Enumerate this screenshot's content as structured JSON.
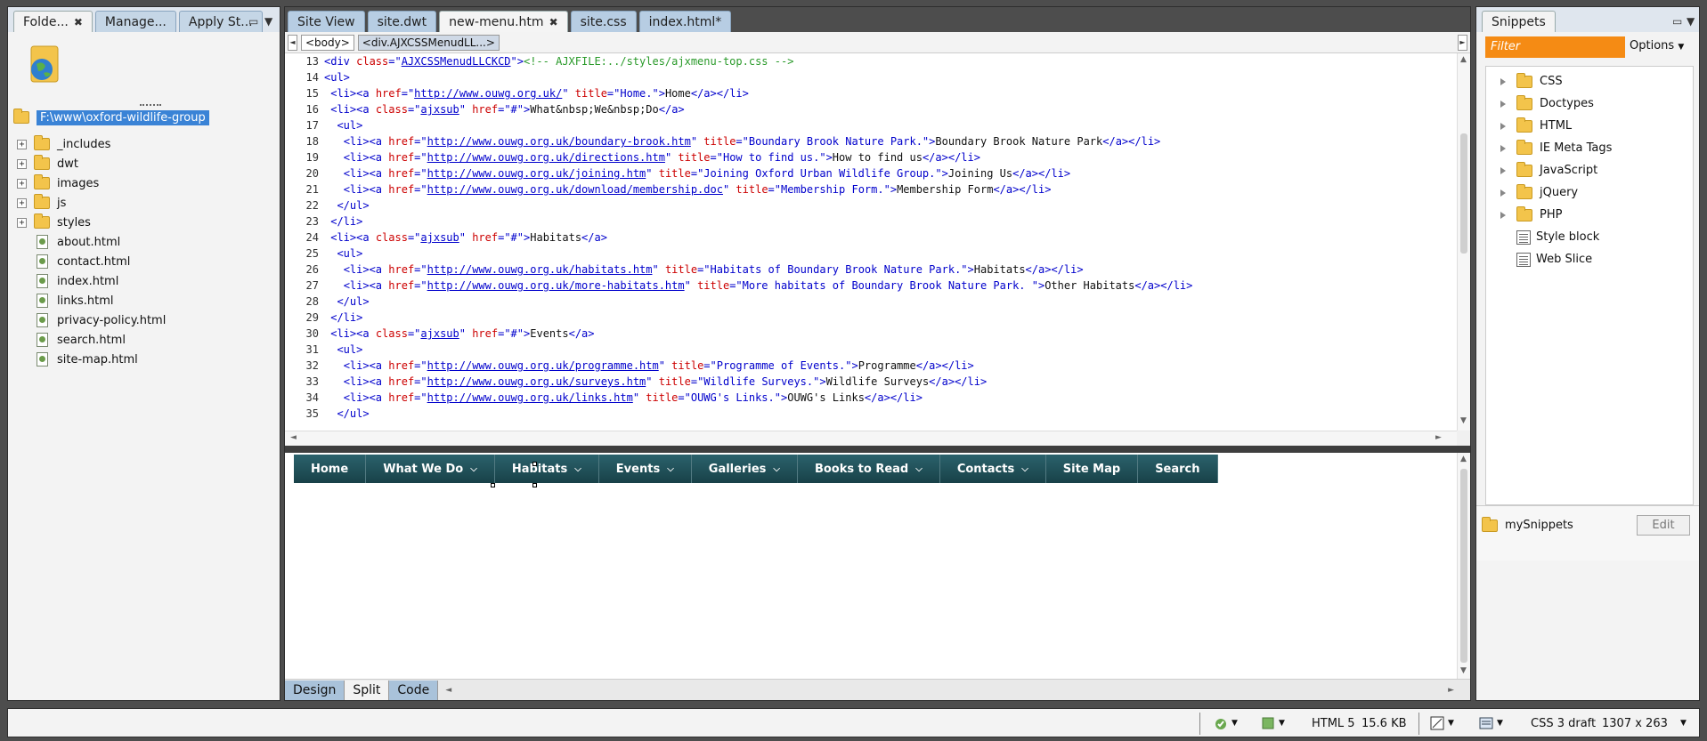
{
  "files_panel": {
    "tabs": [
      {
        "label": "Folde...",
        "close": "✖"
      },
      {
        "label": "Manage..."
      },
      {
        "label": "Apply St..."
      }
    ],
    "root_path": "F:\\www\\oxford-wildlife-group",
    "items": [
      {
        "kind": "folder",
        "name": "_includes"
      },
      {
        "kind": "folder",
        "name": "dwt"
      },
      {
        "kind": "folder",
        "name": "images"
      },
      {
        "kind": "folder",
        "name": "js"
      },
      {
        "kind": "folder",
        "name": "styles"
      },
      {
        "kind": "file",
        "name": "about.html"
      },
      {
        "kind": "file",
        "name": "contact.html"
      },
      {
        "kind": "file",
        "name": "index.html"
      },
      {
        "kind": "file",
        "name": "links.html"
      },
      {
        "kind": "file",
        "name": "privacy-policy.html"
      },
      {
        "kind": "file",
        "name": "search.html"
      },
      {
        "kind": "file",
        "name": "site-map.html"
      }
    ],
    "expander": "+"
  },
  "editor": {
    "tabs": [
      "Site View",
      "site.dwt",
      "new-menu.htm",
      "site.css",
      "index.html*"
    ],
    "active_tab_close": "✖",
    "breadcrumbs": [
      "<body>",
      "<div.AJXCSSMenudLL...>"
    ],
    "code_lines": [
      {
        "n": "13",
        "parts": [
          [
            "tg",
            "<div "
          ],
          [
            "at",
            "class"
          ],
          [
            "tg",
            "=\""
          ],
          [
            "vl",
            "AJXCSSMenudLLCKCD"
          ],
          [
            "tg",
            "\">"
          ],
          [
            "cm",
            "<!-- AJXFILE:../styles/ajxmenu-top.css -->"
          ]
        ]
      },
      {
        "n": "14",
        "parts": [
          [
            "tg",
            "<ul>"
          ]
        ]
      },
      {
        "n": "15",
        "parts": [
          [
            "tx",
            " "
          ],
          [
            "tg",
            "<li><a "
          ],
          [
            "at",
            "href"
          ],
          [
            "tg",
            "=\""
          ],
          [
            "vl",
            "http://www.ouwg.org.uk/"
          ],
          [
            "tg",
            "\" "
          ],
          [
            "at",
            "title"
          ],
          [
            "vs",
            "=\"Home.\""
          ],
          [
            "tg",
            ">"
          ],
          [
            "tx",
            "Home"
          ],
          [
            "tg",
            "</a></li>"
          ]
        ]
      },
      {
        "n": "16",
        "parts": [
          [
            "tx",
            " "
          ],
          [
            "tg",
            "<li><a "
          ],
          [
            "at",
            "class"
          ],
          [
            "tg",
            "=\""
          ],
          [
            "vl",
            "ajxsub"
          ],
          [
            "tg",
            "\" "
          ],
          [
            "at",
            "href"
          ],
          [
            "vs",
            "=\"#\""
          ],
          [
            "tg",
            ">"
          ],
          [
            "tx",
            "What&nbsp;We&nbsp;Do"
          ],
          [
            "tg",
            "</a>"
          ]
        ]
      },
      {
        "n": "17",
        "parts": [
          [
            "tx",
            "  "
          ],
          [
            "tg",
            "<ul>"
          ]
        ]
      },
      {
        "n": "18",
        "parts": [
          [
            "tx",
            "   "
          ],
          [
            "tg",
            "<li><a "
          ],
          [
            "at",
            "href"
          ],
          [
            "tg",
            "=\""
          ],
          [
            "vl",
            "http://www.ouwg.org.uk/boundary-brook.htm"
          ],
          [
            "tg",
            "\" "
          ],
          [
            "at",
            "title"
          ],
          [
            "vs",
            "=\"Boundary Brook Nature Park.\""
          ],
          [
            "tg",
            ">"
          ],
          [
            "tx",
            "Boundary Brook Nature Park"
          ],
          [
            "tg",
            "</a></li>"
          ]
        ]
      },
      {
        "n": "19",
        "parts": [
          [
            "tx",
            "   "
          ],
          [
            "tg",
            "<li><a "
          ],
          [
            "at",
            "href"
          ],
          [
            "tg",
            "=\""
          ],
          [
            "vl",
            "http://www.ouwg.org.uk/directions.htm"
          ],
          [
            "tg",
            "\" "
          ],
          [
            "at",
            "title"
          ],
          [
            "vs",
            "=\"How to find us.\""
          ],
          [
            "tg",
            ">"
          ],
          [
            "tx",
            "How to find us"
          ],
          [
            "tg",
            "</a></li>"
          ]
        ]
      },
      {
        "n": "20",
        "parts": [
          [
            "tx",
            "   "
          ],
          [
            "tg",
            "<li><a "
          ],
          [
            "at",
            "href"
          ],
          [
            "tg",
            "=\""
          ],
          [
            "vl",
            "http://www.ouwg.org.uk/joining.htm"
          ],
          [
            "tg",
            "\" "
          ],
          [
            "at",
            "title"
          ],
          [
            "vs",
            "=\"Joining Oxford Urban Wildlife Group.\""
          ],
          [
            "tg",
            ">"
          ],
          [
            "tx",
            "Joining Us"
          ],
          [
            "tg",
            "</a></li>"
          ]
        ]
      },
      {
        "n": "21",
        "parts": [
          [
            "tx",
            "   "
          ],
          [
            "tg",
            "<li><a "
          ],
          [
            "at",
            "href"
          ],
          [
            "tg",
            "=\""
          ],
          [
            "vl",
            "http://www.ouwg.org.uk/download/membership.doc"
          ],
          [
            "tg",
            "\" "
          ],
          [
            "at",
            "title"
          ],
          [
            "vs",
            "=\"Membership Form.\""
          ],
          [
            "tg",
            ">"
          ],
          [
            "tx",
            "Membership Form"
          ],
          [
            "tg",
            "</a></li>"
          ]
        ]
      },
      {
        "n": "22",
        "parts": [
          [
            "tx",
            "  "
          ],
          [
            "tg",
            "</ul>"
          ]
        ]
      },
      {
        "n": "23",
        "parts": [
          [
            "tx",
            " "
          ],
          [
            "tg",
            "</li>"
          ]
        ]
      },
      {
        "n": "24",
        "parts": [
          [
            "tx",
            " "
          ],
          [
            "tg",
            "<li><a "
          ],
          [
            "at",
            "class"
          ],
          [
            "tg",
            "=\""
          ],
          [
            "vl",
            "ajxsub"
          ],
          [
            "tg",
            "\" "
          ],
          [
            "at",
            "href"
          ],
          [
            "vs",
            "=\"#\""
          ],
          [
            "tg",
            ">"
          ],
          [
            "tx",
            "Habitats"
          ],
          [
            "tg",
            "</a>"
          ]
        ]
      },
      {
        "n": "25",
        "parts": [
          [
            "tx",
            "  "
          ],
          [
            "tg",
            "<ul>"
          ]
        ]
      },
      {
        "n": "26",
        "parts": [
          [
            "tx",
            "   "
          ],
          [
            "tg",
            "<li><a "
          ],
          [
            "at",
            "href"
          ],
          [
            "tg",
            "=\""
          ],
          [
            "vl",
            "http://www.ouwg.org.uk/habitats.htm"
          ],
          [
            "tg",
            "\" "
          ],
          [
            "at",
            "title"
          ],
          [
            "vs",
            "=\"Habitats of Boundary Brook Nature Park.\""
          ],
          [
            "tg",
            ">"
          ],
          [
            "tx",
            "Habitats"
          ],
          [
            "tg",
            "</a></li>"
          ]
        ]
      },
      {
        "n": "27",
        "parts": [
          [
            "tx",
            "   "
          ],
          [
            "tg",
            "<li><a "
          ],
          [
            "at",
            "href"
          ],
          [
            "tg",
            "=\""
          ],
          [
            "vl",
            "http://www.ouwg.org.uk/more-habitats.htm"
          ],
          [
            "tg",
            "\" "
          ],
          [
            "at",
            "title"
          ],
          [
            "vs",
            "=\"More habitats of Boundary Brook Nature Park. \""
          ],
          [
            "tg",
            ">"
          ],
          [
            "tx",
            "Other Habitats"
          ],
          [
            "tg",
            "</a></li>"
          ]
        ]
      },
      {
        "n": "28",
        "parts": [
          [
            "tx",
            "  "
          ],
          [
            "tg",
            "</ul>"
          ]
        ]
      },
      {
        "n": "29",
        "parts": [
          [
            "tx",
            " "
          ],
          [
            "tg",
            "</li>"
          ]
        ]
      },
      {
        "n": "30",
        "parts": [
          [
            "tx",
            " "
          ],
          [
            "tg",
            "<li><a "
          ],
          [
            "at",
            "class"
          ],
          [
            "tg",
            "=\""
          ],
          [
            "vl",
            "ajxsub"
          ],
          [
            "tg",
            "\" "
          ],
          [
            "at",
            "href"
          ],
          [
            "vs",
            "=\"#\""
          ],
          [
            "tg",
            ">"
          ],
          [
            "tx",
            "Events"
          ],
          [
            "tg",
            "</a>"
          ]
        ]
      },
      {
        "n": "31",
        "parts": [
          [
            "tx",
            "  "
          ],
          [
            "tg",
            "<ul>"
          ]
        ]
      },
      {
        "n": "32",
        "parts": [
          [
            "tx",
            "   "
          ],
          [
            "tg",
            "<li><a "
          ],
          [
            "at",
            "href"
          ],
          [
            "tg",
            "=\""
          ],
          [
            "vl",
            "http://www.ouwg.org.uk/programme.htm"
          ],
          [
            "tg",
            "\" "
          ],
          [
            "at",
            "title"
          ],
          [
            "vs",
            "=\"Programme of Events.\""
          ],
          [
            "tg",
            ">"
          ],
          [
            "tx",
            "Programme"
          ],
          [
            "tg",
            "</a></li>"
          ]
        ]
      },
      {
        "n": "33",
        "parts": [
          [
            "tx",
            "   "
          ],
          [
            "tg",
            "<li><a "
          ],
          [
            "at",
            "href"
          ],
          [
            "tg",
            "=\""
          ],
          [
            "vl",
            "http://www.ouwg.org.uk/surveys.htm"
          ],
          [
            "tg",
            "\" "
          ],
          [
            "at",
            "title"
          ],
          [
            "vs",
            "=\"Wildlife Surveys.\""
          ],
          [
            "tg",
            ">"
          ],
          [
            "tx",
            "Wildlife Surveys"
          ],
          [
            "tg",
            "</a></li>"
          ]
        ]
      },
      {
        "n": "34",
        "parts": [
          [
            "tx",
            "   "
          ],
          [
            "tg",
            "<li><a "
          ],
          [
            "at",
            "href"
          ],
          [
            "tg",
            "=\""
          ],
          [
            "vl",
            "http://www.ouwg.org.uk/links.htm"
          ],
          [
            "tg",
            "\" "
          ],
          [
            "at",
            "title"
          ],
          [
            "vs",
            "=\"OUWG's Links.\""
          ],
          [
            "tg",
            ">"
          ],
          [
            "tx",
            "OUWG's Links"
          ],
          [
            "tg",
            "</a></li>"
          ]
        ]
      },
      {
        "n": "35",
        "parts": [
          [
            "tx",
            "  "
          ],
          [
            "tg",
            "</ul>"
          ]
        ]
      }
    ],
    "design_menu": [
      {
        "label": "Home",
        "sub": false
      },
      {
        "label": "What We Do",
        "sub": true
      },
      {
        "label": "Habitats",
        "sub": true
      },
      {
        "label": "Events",
        "sub": true
      },
      {
        "label": "Galleries",
        "sub": true
      },
      {
        "label": "Books to Read",
        "sub": true
      },
      {
        "label": "Contacts",
        "sub": true
      },
      {
        "label": "Site Map",
        "sub": false
      },
      {
        "label": "Search",
        "sub": false
      }
    ],
    "menu_color": "#1f4d56",
    "view_buttons": [
      "Design",
      "Split",
      "Code"
    ],
    "active_view": "Split"
  },
  "snippets_panel": {
    "tab": "Snippets",
    "filter_placeholder": "Filter",
    "options_label": "Options",
    "folders": [
      "CSS",
      "Doctypes",
      "HTML",
      "IE Meta Tags",
      "JavaScript",
      "jQuery",
      "PHP"
    ],
    "items": [
      "Style block",
      "Web Slice"
    ],
    "my_snippets": "mySnippets",
    "edit_label": "Edit",
    "filter_color": "#f58b14"
  },
  "status_bar": {
    "doctype": "HTML 5",
    "size": "15.6 KB",
    "css_mode": "CSS 3 draft",
    "dimensions": "1307 x 263"
  },
  "arrow_down": "▼",
  "arrow_left": "◄",
  "arrow_right": "►",
  "arrow_up": "▲",
  "pin_glyph": "▭",
  "chevron_glyph": "⌵"
}
